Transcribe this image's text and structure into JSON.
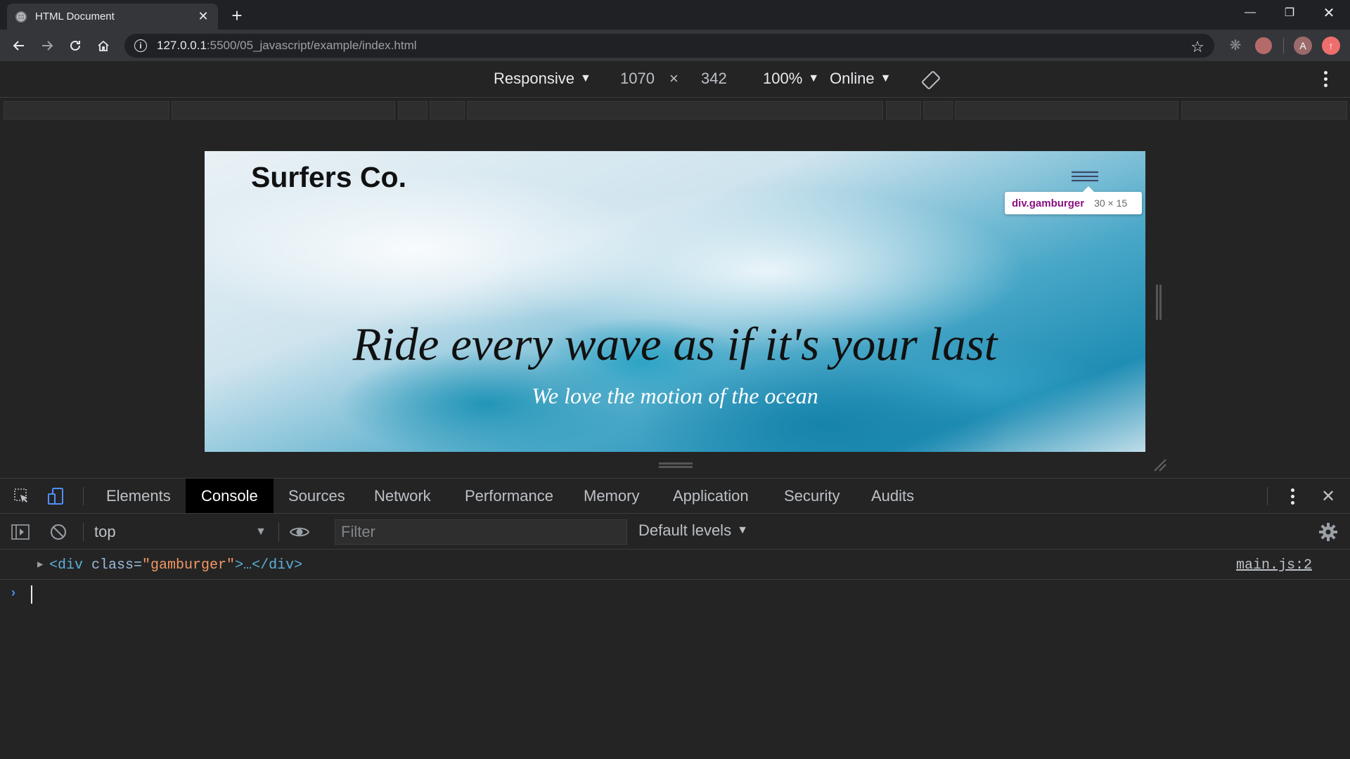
{
  "browser": {
    "tab_title": "HTML Document",
    "url_host": "127.0.0.1",
    "url_path": ":5500/05_javascript/example/index.html",
    "avatar_letter": "A"
  },
  "device_toolbar": {
    "device": "Responsive",
    "width": "1070",
    "times": "×",
    "height": "342",
    "zoom": "100%",
    "throttling": "Online"
  },
  "page": {
    "logo": "Surfers Co.",
    "hero_title": "Ride every wave as if it's your last",
    "hero_subtitle": "We love the motion of the ocean",
    "inspect_tooltip": {
      "tag": "div.gamburger",
      "size": "30 × 15"
    }
  },
  "devtools": {
    "tabs": [
      "Elements",
      "Console",
      "Sources",
      "Network",
      "Performance",
      "Memory",
      "Application",
      "Security",
      "Audits"
    ],
    "active_tab": "Console",
    "context": "top",
    "filter_placeholder": "Filter",
    "levels": "Default levels",
    "log": {
      "tag_open": "<div",
      "attr_name": " class=",
      "attr_value": "\"gamburger\"",
      "tag_rest": ">…</div>",
      "source": "main.js:2"
    }
  },
  "colors": {
    "devtools_bg": "#242424",
    "active_tab_bg": "#000000",
    "tooltip_tag": "#881280",
    "prompt": "#4d90fe"
  }
}
